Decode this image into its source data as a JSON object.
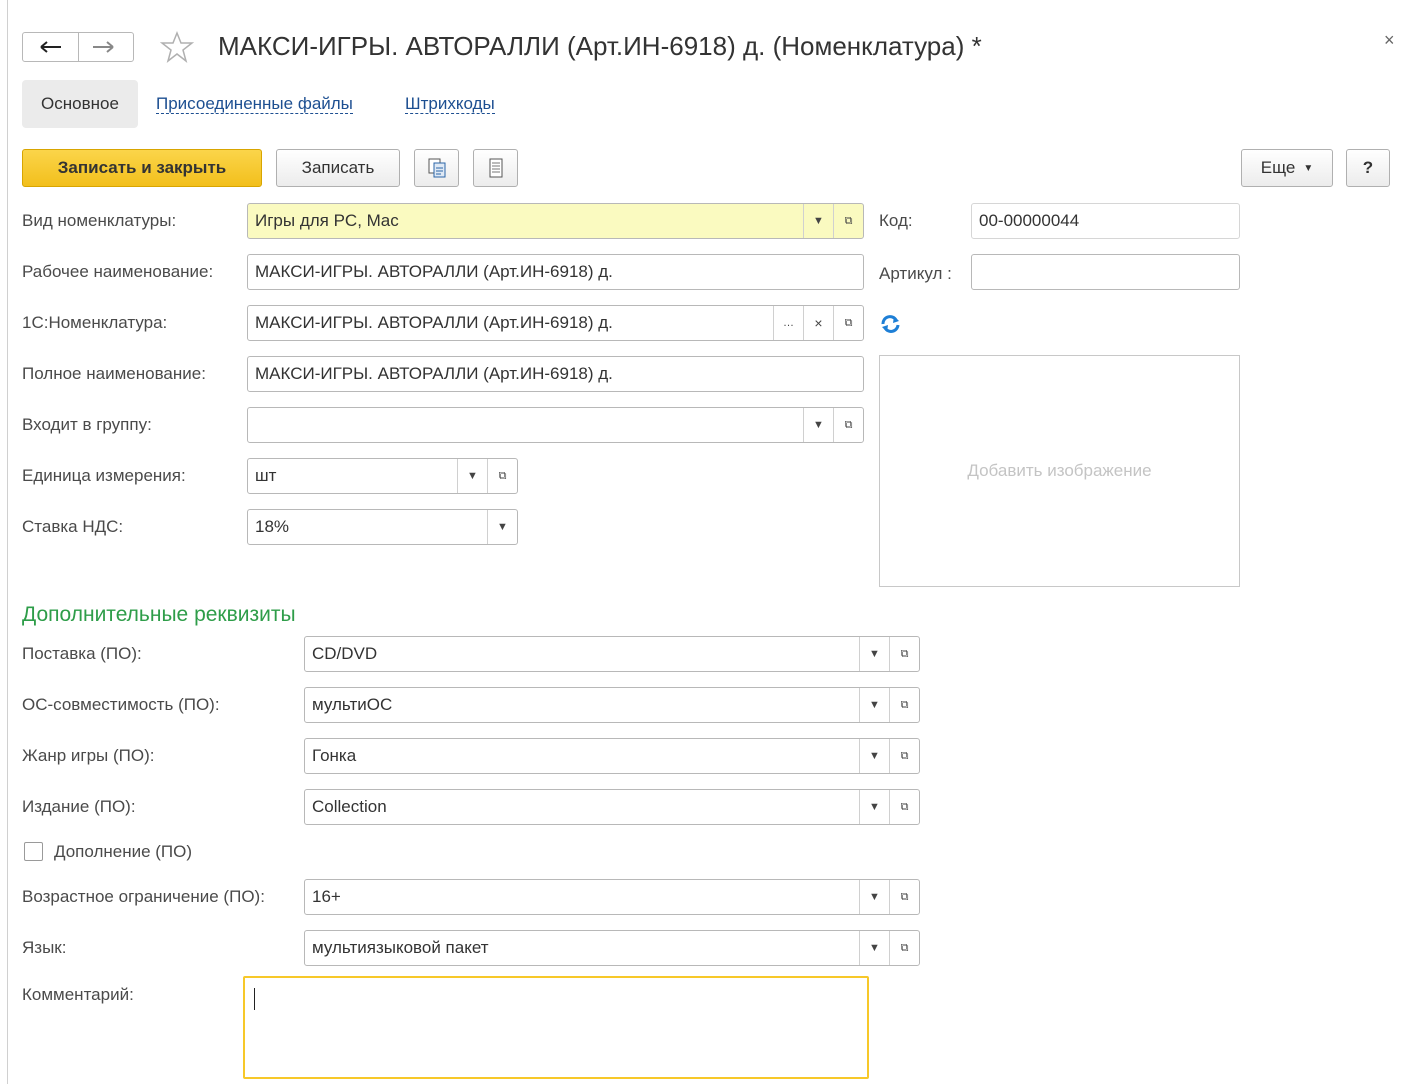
{
  "window": {
    "title": "МАКСИ-ИГРЫ. АВТОРАЛЛИ (Арт.ИН-6918) д. (Номенклатура) *"
  },
  "tabs": [
    {
      "label": "Основное"
    },
    {
      "label": "Присоединенные файлы"
    },
    {
      "label": "Штрихкоды"
    }
  ],
  "toolbar": {
    "save_close_label": "Записать и закрыть",
    "save_label": "Записать",
    "more_label": "Еще",
    "help_label": "?"
  },
  "form": {
    "kind": {
      "label": "Вид номенклатуры:",
      "value": "Игры для PC, Mac"
    },
    "work_name": {
      "label": "Рабочее наименование:",
      "value": "МАКСИ-ИГРЫ. АВТОРАЛЛИ (Арт.ИН-6918) д."
    },
    "nom_1c": {
      "label": "1С:Номенклатура:",
      "value": "МАКСИ-ИГРЫ. АВТОРАЛЛИ (Арт.ИН-6918) д."
    },
    "full_name": {
      "label": "Полное наименование:",
      "value": "МАКСИ-ИГРЫ. АВТОРАЛЛИ (Арт.ИН-6918) д."
    },
    "group": {
      "label": "Входит в группу:",
      "value": ""
    },
    "unit": {
      "label": "Единица измерения:",
      "value": "шт"
    },
    "vat": {
      "label": "Ставка НДС:",
      "value": "18%"
    },
    "code": {
      "label": "Код:",
      "value": "00-00000044"
    },
    "article": {
      "label": "Артикул :",
      "value": ""
    },
    "image_placeholder": "Добавить изображение"
  },
  "extra": {
    "title": "Дополнительные реквизиты",
    "delivery": {
      "label": "Поставка (ПО):",
      "value": "CD/DVD"
    },
    "os": {
      "label": "ОС-совместимость (ПО):",
      "value": "мультиОС"
    },
    "genre": {
      "label": "Жанр игры (ПО):",
      "value": "Гонка"
    },
    "edition": {
      "label": "Издание (ПО):",
      "value": "Collection"
    },
    "addon": {
      "label": "Дополнение (ПО)",
      "checked": false
    },
    "age": {
      "label": "Возрастное ограничение (ПО):",
      "value": "16+"
    },
    "language": {
      "label": "Язык:",
      "value": "мультиязыковой пакет"
    },
    "comment": {
      "label": "Комментарий:",
      "value": ""
    }
  },
  "colors": {
    "accent_yellow": "#f7c829",
    "section_green": "#2e9d49",
    "link_blue": "#1d4f91",
    "highlight_field": "#fafac0"
  }
}
